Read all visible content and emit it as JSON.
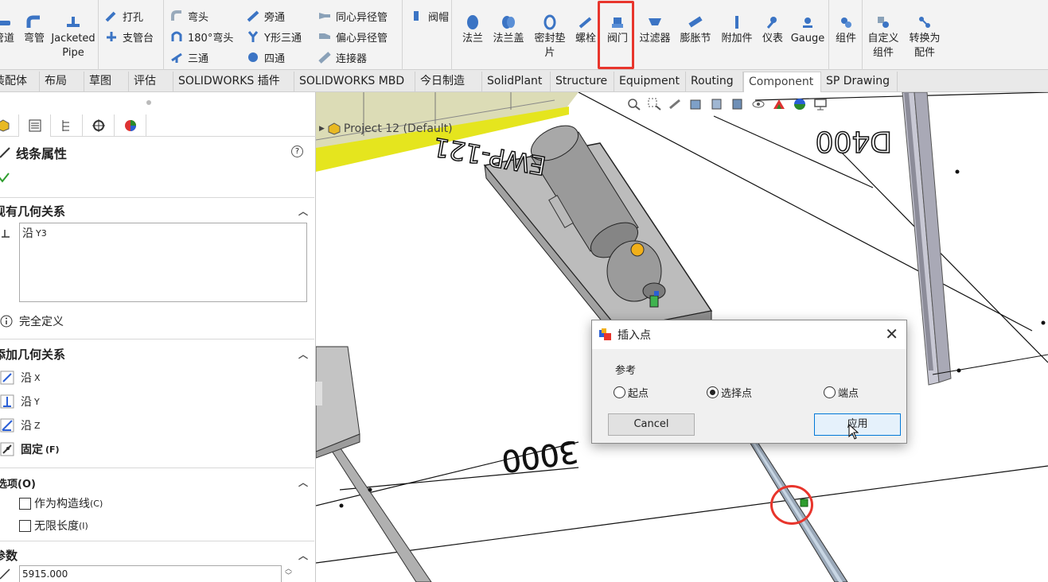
{
  "ribbon": {
    "buttons": [
      {
        "label": "管道",
        "icon": "pipe-icon"
      },
      {
        "label": "弯管",
        "icon": "bend-pipe-icon"
      },
      {
        "label": "Jacketed Pipe",
        "icon": "jacketed-pipe-icon"
      }
    ],
    "small_col1": [
      {
        "label": "打孔",
        "icon": "drill-icon"
      },
      {
        "label": "支管台",
        "icon": "branch-icon"
      }
    ],
    "small_col2": [
      {
        "label": "弯头",
        "icon": "elbow-icon"
      },
      {
        "label": "180°弯头",
        "icon": "elbow-180-icon"
      },
      {
        "label": "三通",
        "icon": "tee-icon"
      }
    ],
    "small_col3": [
      {
        "label": "旁通",
        "icon": "bypass-icon"
      },
      {
        "label": "Y形三通",
        "icon": "y-tee-icon"
      },
      {
        "label": "四通",
        "icon": "cross-icon"
      }
    ],
    "small_col4": [
      {
        "label": "同心异径管",
        "icon": "concentric-reducer-icon"
      },
      {
        "label": "偏心异径管",
        "icon": "eccentric-reducer-icon"
      },
      {
        "label": "连接器",
        "icon": "connector-icon"
      }
    ],
    "small_col5": [
      {
        "label": "阀帽",
        "icon": "cap-icon"
      }
    ],
    "big": [
      {
        "label": "法兰",
        "icon": "flange-icon"
      },
      {
        "label": "法兰盖",
        "icon": "blind-flange-icon"
      },
      {
        "label": "密封垫",
        "label2": "片",
        "icon": "gasket-icon"
      },
      {
        "label": "螺栓",
        "icon": "bolt-icon"
      },
      {
        "label": "阀门",
        "icon": "valve-icon"
      },
      {
        "label": "过滤器",
        "icon": "filter-icon"
      },
      {
        "label": "膨胀节",
        "icon": "expansion-joint-icon"
      },
      {
        "label": "附加件",
        "icon": "attachment-icon"
      },
      {
        "label": "仪表",
        "icon": "instrument-icon"
      },
      {
        "label": "Gauge",
        "icon": "gauge-icon"
      },
      {
        "label": "组件",
        "icon": "assembly-icon"
      },
      {
        "label": "自定义",
        "label2": "组件",
        "icon": "custom-assembly-icon"
      },
      {
        "label": "转换为",
        "label2": "配件",
        "icon": "convert-icon"
      }
    ]
  },
  "tabs": [
    "装配体",
    "布局",
    "草图",
    "评估",
    "SOLIDWORKS 插件",
    "SOLIDWORKS MBD",
    "今日制造",
    "SolidPlant",
    "Structure",
    "Equipment",
    "Routing",
    "Component",
    "SP Drawing"
  ],
  "active_tab": "Component",
  "panel": {
    "title": "线条属性",
    "help": "?",
    "existing_title": "现有几何关系",
    "existing_item": "沿",
    "existing_item_sub": "Y3",
    "status": "完全定义",
    "add_title": "添加几何关系",
    "add_items": [
      {
        "label": "沿",
        "sub": "X"
      },
      {
        "label": "沿",
        "sub": "Y"
      },
      {
        "label": "沿",
        "sub": "Z"
      },
      {
        "label": "固定",
        "sub": "(F)"
      }
    ],
    "options_title": "选项(O)",
    "options": [
      {
        "label": "作为构造线",
        "sub": "(C)"
      },
      {
        "label": "无限长度",
        "sub": "(I)"
      }
    ],
    "params_title": "参数",
    "param_value": "5915.000"
  },
  "viewport": {
    "breadcrumb": "Project 12  (Default)",
    "dim_labels": [
      "3000",
      "D400",
      "EWP-121"
    ]
  },
  "dialog": {
    "title": "插入点",
    "group": "参考",
    "radios": [
      {
        "label": "起点",
        "checked": false
      },
      {
        "label": "选择点",
        "checked": true
      },
      {
        "label": "端点",
        "checked": false
      }
    ],
    "cancel": "Cancel",
    "apply": "应用"
  },
  "colors": {
    "highlight": "#e8352c",
    "ribbon_bg": "#f3f3f3",
    "pipe_icon": "#3b74c4",
    "equipment_fill": "#b8b8b8"
  }
}
